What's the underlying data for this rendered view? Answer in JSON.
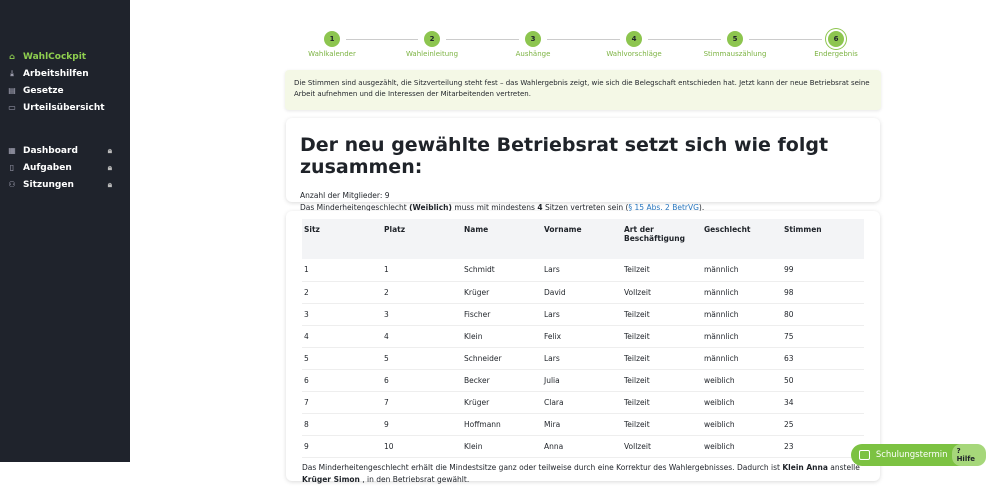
{
  "sidebar": {
    "items": [
      {
        "label": "WahlCockpit",
        "icon": "home-icon",
        "active": true
      },
      {
        "label": "Arbeitshilfen",
        "icon": "download-icon"
      },
      {
        "label": "Gesetze",
        "icon": "book-icon"
      },
      {
        "label": "Urteilsübersicht",
        "icon": "folder-icon"
      }
    ],
    "locked": [
      {
        "label": "Dashboard",
        "icon": "dashboard-icon"
      },
      {
        "label": "Aufgaben",
        "icon": "clipboard-icon"
      },
      {
        "label": "Sitzungen",
        "icon": "people-icon"
      }
    ]
  },
  "steps": [
    {
      "n": "1",
      "label": "Wahlkalender"
    },
    {
      "n": "2",
      "label": "Wahleinleitung"
    },
    {
      "n": "3",
      "label": "Aushänge"
    },
    {
      "n": "4",
      "label": "Wahlvorschläge"
    },
    {
      "n": "5",
      "label": "Stimmauszählung"
    },
    {
      "n": "6",
      "label": "Endergebnis"
    }
  ],
  "info": "Die Stimmen sind ausgezählt, die Sitzverteilung steht fest – das Wahlergebnis zeigt, wie sich die Belegschaft entschieden hat. Jetzt kann der neue Betriebsrat seine Arbeit aufnehmen und die Interessen der Mitarbeitenden vertreten.",
  "result": {
    "title": "Der neu gewählte Betriebsrat setzt sich wie folgt zusammen:",
    "members_label": "Anzahl der Mitglieder:",
    "members": "9",
    "minority_pre": "Das Minderheitengeschlecht ",
    "minority_gender": "(Weiblich)",
    "minority_mid": " muss mit mindestens ",
    "minority_seats": "4",
    "minority_post": " Sitzen vertreten sein (",
    "law_link": "§ 15 Abs. 2 BetrVG",
    "minority_end": ")."
  },
  "table": {
    "headers": [
      "Sitz",
      "Platz",
      "Name",
      "Vorname",
      "Art der Beschäftigung",
      "Geschlecht",
      "Stimmen"
    ],
    "rows": [
      [
        "1",
        "1",
        "Schmidt",
        "Lars",
        "Teilzeit",
        "männlich",
        "99"
      ],
      [
        "2",
        "2",
        "Krüger",
        "David",
        "Vollzeit",
        "männlich",
        "98"
      ],
      [
        "3",
        "3",
        "Fischer",
        "Lars",
        "Teilzeit",
        "männlich",
        "80"
      ],
      [
        "4",
        "4",
        "Klein",
        "Felix",
        "Teilzeit",
        "männlich",
        "75"
      ],
      [
        "5",
        "5",
        "Schneider",
        "Lars",
        "Teilzeit",
        "männlich",
        "63"
      ],
      [
        "6",
        "6",
        "Becker",
        "Julia",
        "Teilzeit",
        "weiblich",
        "50"
      ],
      [
        "7",
        "7",
        "Krüger",
        "Clara",
        "Teilzeit",
        "weiblich",
        "34"
      ],
      [
        "8",
        "9",
        "Hoffmann",
        "Mira",
        "Teilzeit",
        "weiblich",
        "25"
      ],
      [
        "9",
        "10",
        "Klein",
        "Anna",
        "Vollzeit",
        "weiblich",
        "23"
      ]
    ]
  },
  "footer": {
    "pre": "Das Minderheitengeschlecht erhält die Mindestsitze ganz oder teilweise durch eine Korrektur des Wahlergebnisses. Dadurch ist ",
    "in": "Klein Anna",
    "mid": " anstelle ",
    "out": "Krüger Simon",
    "post": " , in den Betriebsrat gewählt."
  },
  "floating": {
    "schulung": "Schulungstermin",
    "hilfe": "Hilfe"
  },
  "colors": {
    "accent": "#8dc54f",
    "sidebar": "#1f232c"
  }
}
